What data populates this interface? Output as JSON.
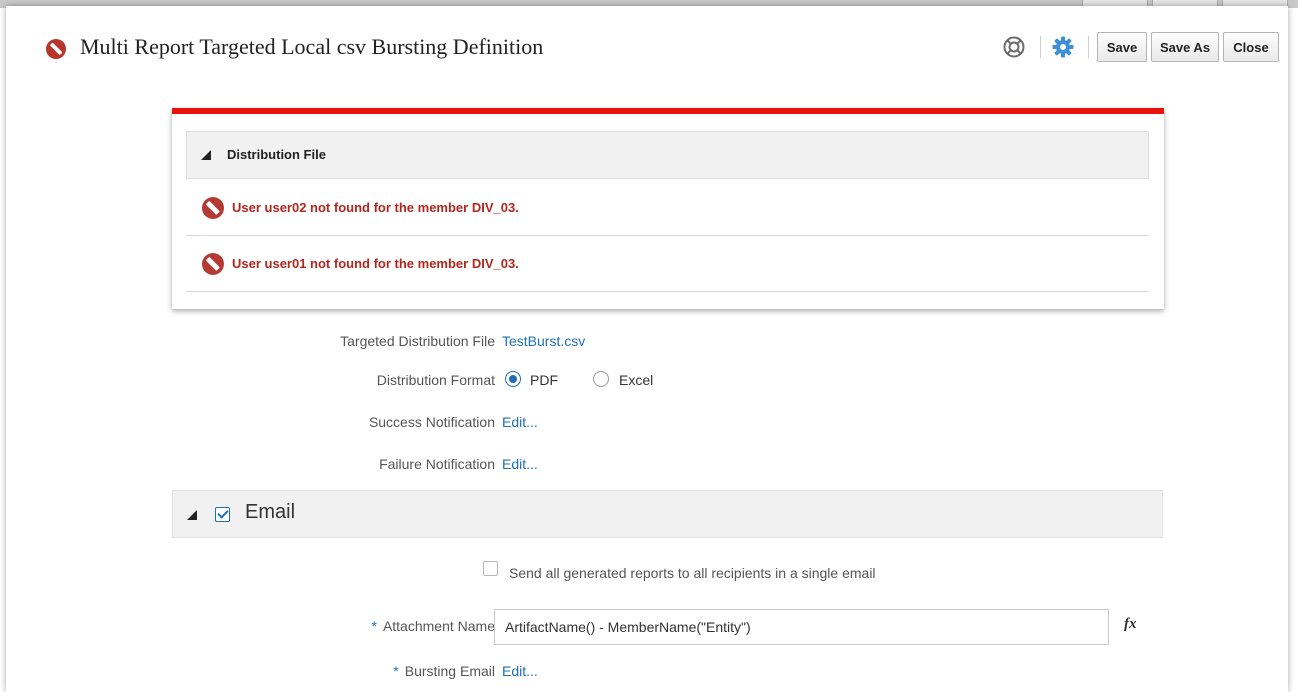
{
  "header": {
    "title": "Multi Report Targeted Local csv Bursting Definition",
    "buttons": {
      "save": "Save",
      "save_as": "Save As",
      "close": "Close"
    }
  },
  "messages": {
    "section_label": "Distribution File",
    "items": [
      "User user02 not found for the member DIV_03.",
      "User user01 not found for the member DIV_03."
    ]
  },
  "form": {
    "targeted_distribution_file": {
      "label": "Targeted Distribution File",
      "value": "TestBurst.csv"
    },
    "distribution_format": {
      "label": "Distribution Format",
      "options": [
        "PDF",
        "Excel"
      ],
      "selected": "PDF"
    },
    "success_notification": {
      "label": "Success Notification",
      "link": "Edit..."
    },
    "failure_notification": {
      "label": "Failure Notification",
      "link": "Edit..."
    }
  },
  "email": {
    "section_title": "Email",
    "enabled": true,
    "single_email_label": "Send all generated reports to all recipients in a single email",
    "single_email_checked": false,
    "attachment_name": {
      "required_mark": "*",
      "label": "Attachment Name",
      "value": "ArtifactName() - MemberName(\"Entity\")"
    },
    "formula_icon": "fx",
    "bursting_email": {
      "required_mark": "*",
      "label": "Bursting Email",
      "link": "Edit..."
    }
  },
  "colors": {
    "error_red": "#b3261e",
    "alert_bar": "#e8120c",
    "link_blue": "#1f6fb5",
    "gear_blue": "#3d8fd6"
  },
  "icons": [
    "error-icon",
    "help-icon",
    "gear-icon",
    "collapse-triangle-icon",
    "formula-icon"
  ]
}
